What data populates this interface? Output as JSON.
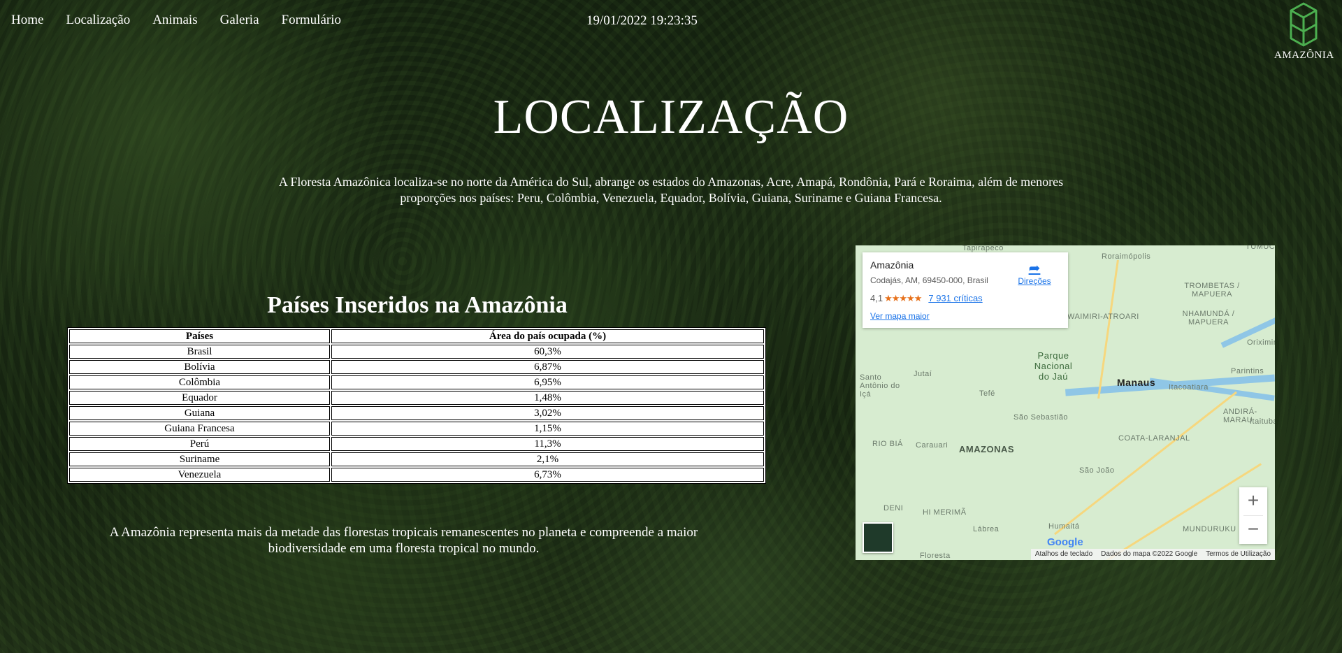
{
  "nav": {
    "items": [
      "Home",
      "Localização",
      "Animais",
      "Galeria",
      "Formulário"
    ]
  },
  "clock": "19/01/2022 19:23:35",
  "logo": {
    "text": "AMAZÔNIA",
    "icon": "cube-icon",
    "color": "#4caf50"
  },
  "title": "LOCALIZAÇÃO",
  "intro": "A Floresta Amazônica localiza-se no norte da América do Sul, abrange os estados do Amazonas, Acre, Amapá, Rondônia, Pará e Roraima, além de menores proporções nos países: Peru, Colômbia, Venezuela, Equador, Bolívia, Guiana, Suriname e Guiana Francesa.",
  "table": {
    "title": "Países Inseridos na Amazônia",
    "headers": [
      "Países",
      "Área do país ocupada (%)"
    ],
    "rows": [
      [
        "Brasil",
        "60,3%"
      ],
      [
        "Bolívia",
        "6,87%"
      ],
      [
        "Colômbia",
        "6,95%"
      ],
      [
        "Equador",
        "1,48%"
      ],
      [
        "Guiana",
        "3,02%"
      ],
      [
        "Guiana Francesa",
        "1,15%"
      ],
      [
        "Perú",
        "11,3%"
      ],
      [
        "Suriname",
        "2,1%"
      ],
      [
        "Venezuela",
        "6,73%"
      ]
    ]
  },
  "outro": "A Amazônia representa mais da metade das florestas tropicais remanescentes no planeta e compreende a maior biodiversidade em uma floresta tropical no mundo.",
  "map": {
    "place": "Amazônia",
    "address": "Codajás, AM, 69450-000, Brasil",
    "rating": "4,1",
    "stars": "★★★★★",
    "reviews": "7 931 críticas",
    "more": "Ver mapa maior",
    "directions": "Direções",
    "zoom_in": "+",
    "zoom_out": "−",
    "google": "Google",
    "footer": [
      "Atalhos de teclado",
      "Dados do mapa ©2022 Google",
      "Termos de Utilização"
    ],
    "labels": {
      "tapirapeco": "Tapirapeco",
      "roraimopolis": "Roraimópolis",
      "trombetas": "TROMBETAS / MAPUERA",
      "nhamunda": "NHAMUNDÁ / MAPUERA",
      "waimiri": "WAIMIRI-ATROARI",
      "parque": "Parque Nacional do Jaú",
      "manaus": "Manaus",
      "santo_antonio": "Santo Antônio do Içá",
      "jutai": "Jutaí",
      "tefe": "Tefé",
      "itacoatiara": "Itacoatiara",
      "parintins": "Parintins",
      "oriximina": "Oriximiná",
      "sao_sebastiao": "São Sebastião",
      "andira": "ANDIRÁ-MARAU",
      "itaituba": "Itaituba",
      "coata": "COATA-LARANJAL",
      "rio_bia": "RIO BIÁ",
      "carauari": "Carauari",
      "amazonas": "AMAZONAS",
      "sao_joao": "São João",
      "deni": "DENI",
      "hi_merima": "HI MERIMÃ",
      "labrea": "Lábrea",
      "humaita": "Humaitá",
      "munduruku": "MUNDURUKU",
      "floresta": "Floresta",
      "tumuc": "TUMUC"
    }
  }
}
